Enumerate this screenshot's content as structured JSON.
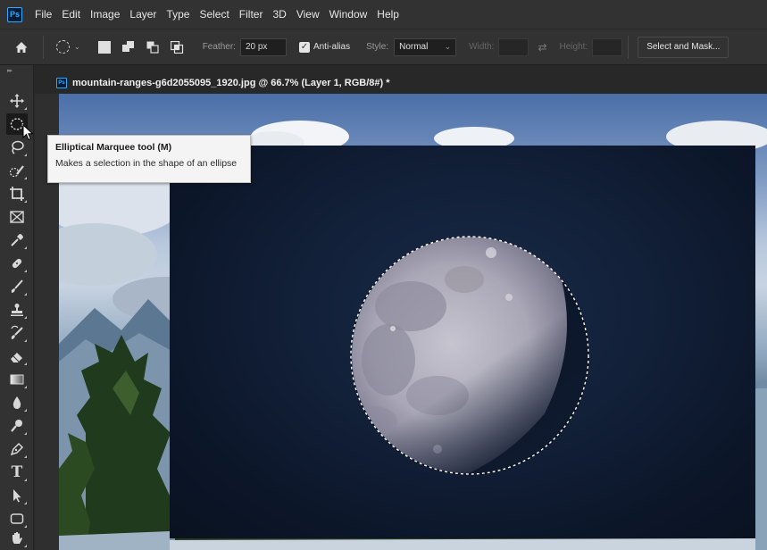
{
  "app": {
    "logo_text": "Ps"
  },
  "menu": [
    "File",
    "Edit",
    "Image",
    "Layer",
    "Type",
    "Select",
    "Filter",
    "3D",
    "View",
    "Window",
    "Help"
  ],
  "options_bar": {
    "feather_label": "Feather:",
    "feather_value": "20 px",
    "antialias_label": "Anti-alias",
    "antialias_checked": true,
    "style_label": "Style:",
    "style_value": "Normal",
    "width_label": "Width:",
    "height_label": "Height:",
    "select_mask_label": "Select and Mask..."
  },
  "document": {
    "tab_title": "mountain-ranges-g6d2055095_1920.jpg @ 66.7% (Layer 1, RGB/8#) *"
  },
  "tooltip": {
    "title": "Elliptical Marquee tool (M)",
    "description": "Makes a selection in the shape of an ellipse"
  },
  "tools": [
    {
      "name": "move-tool",
      "icon": "move-icon"
    },
    {
      "name": "elliptical-marquee-tool",
      "icon": "elliptical-marquee-icon",
      "active": true
    },
    {
      "name": "lasso-tool",
      "icon": "lasso-icon"
    },
    {
      "name": "quick-selection-tool",
      "icon": "quick-selection-icon"
    },
    {
      "name": "crop-tool",
      "icon": "crop-icon"
    },
    {
      "name": "frame-tool",
      "icon": "frame-icon"
    },
    {
      "name": "eyedropper-tool",
      "icon": "eyedropper-icon"
    },
    {
      "name": "healing-brush-tool",
      "icon": "bandage-icon"
    },
    {
      "name": "brush-tool",
      "icon": "brush-icon"
    },
    {
      "name": "clone-stamp-tool",
      "icon": "stamp-icon"
    },
    {
      "name": "history-brush-tool",
      "icon": "history-brush-icon"
    },
    {
      "name": "eraser-tool",
      "icon": "eraser-icon"
    },
    {
      "name": "gradient-tool",
      "icon": "gradient-icon"
    },
    {
      "name": "blur-tool",
      "icon": "drop-icon"
    },
    {
      "name": "dodge-tool",
      "icon": "dodge-icon"
    },
    {
      "name": "pen-tool",
      "icon": "pen-icon"
    },
    {
      "name": "type-tool",
      "icon": "type-icon",
      "glyph": "T"
    },
    {
      "name": "path-selection-tool",
      "icon": "arrow-icon"
    },
    {
      "name": "shape-tool",
      "icon": "rectangle-icon"
    },
    {
      "name": "hand-tool",
      "icon": "hand-icon"
    }
  ],
  "colors": {
    "panel": "#323232",
    "background": "#282828",
    "accent": "#31a8ff"
  }
}
